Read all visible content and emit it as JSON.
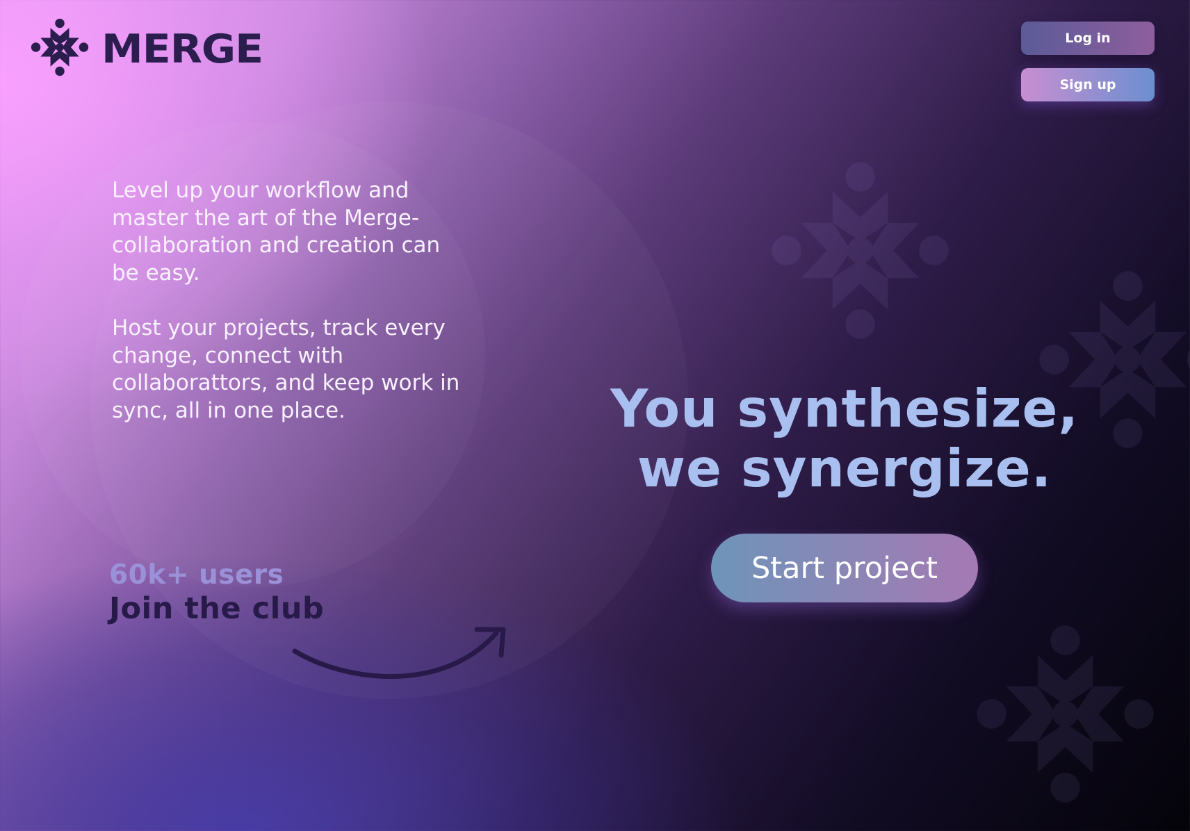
{
  "brand": {
    "name": "MERGE",
    "logo_icon": "merge-logo-icon"
  },
  "auth": {
    "login_label": "Log in",
    "signup_label": "Sign up"
  },
  "hero": {
    "paragraph_1": "Level up your workflow and master the art of the Merge-collaboration and creation can be easy.",
    "paragraph_2": "Host your projects, track every change, connect with collaborattors, and keep work in sync, all in one place.",
    "headline_line_1": "You synthesize,",
    "headline_line_2": "we synergize.",
    "cta_label": "Start project"
  },
  "stats": {
    "users": "60k+ users",
    "join": "Join  the club"
  },
  "icons": {
    "arrow": "curved-arrow-icon",
    "watermark": "merge-watermark-icon"
  },
  "colors": {
    "headline": "#a8bff0",
    "logo_text": "#2b1d4e",
    "users_text": "#9b91d8",
    "join_text": "#271a49",
    "cta_start": "#6e94b9",
    "cta_end": "#a579b3"
  }
}
